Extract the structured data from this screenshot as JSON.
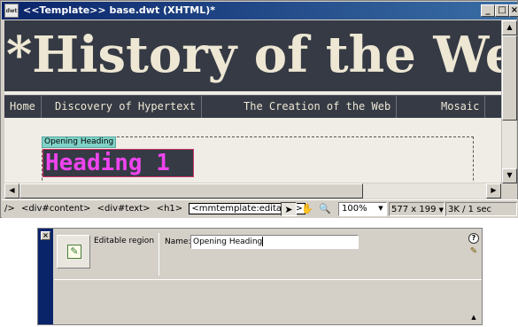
{
  "window": {
    "title": "<<Template>> base.dwt (XHTML)*",
    "app_icon_label": "dwt",
    "buttons": {
      "minimize": "_",
      "maximize": "□",
      "close": "×"
    }
  },
  "page": {
    "banner_title": "*History of the Web",
    "nav_items": [
      "Home",
      "Discovery of Hypertext",
      "The Creation of the Web",
      "Mosaic"
    ],
    "editable_region_label": "Opening Heading",
    "heading_text": "Heading 1"
  },
  "statusbar": {
    "tags": [
      "/>",
      "<div#content>",
      "<div#text>",
      "<h1>",
      "<mmtemplate:editable>"
    ],
    "zoom": "100%",
    "window_size": "577 x 199",
    "download": "3K / 1 sec"
  },
  "property_inspector": {
    "region_type": "Editable region",
    "name_label": "Name:",
    "name_value": "Opening Heading",
    "help": "?"
  },
  "colors": {
    "titlebar": "#0a246a",
    "banner_bg": "#353a44",
    "banner_text": "#ede7d4",
    "heading_text": "#ee44ee",
    "region_tab": "#7fd2c7"
  },
  "icons": {
    "select_tool": "arrow-pointer-icon",
    "hand_tool": "hand-icon",
    "zoom_tool": "magnifier-icon",
    "region": "editable-region-icon",
    "edit": "quick-tag-edit-icon",
    "expand": "expand-triangle-icon"
  }
}
